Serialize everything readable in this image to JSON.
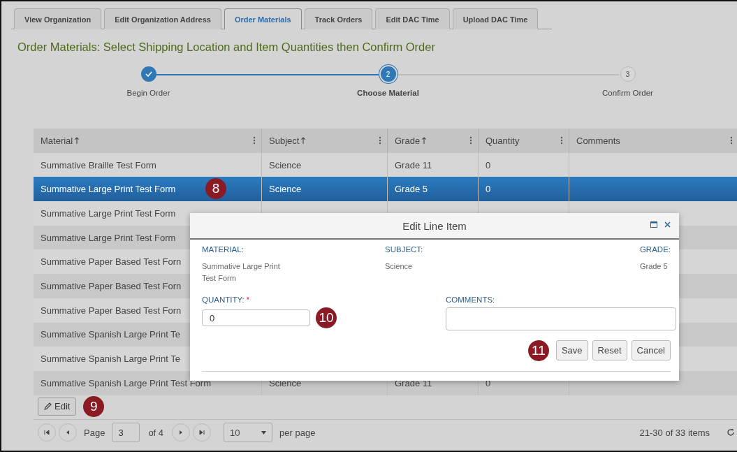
{
  "tabs": [
    {
      "label": "View Organization",
      "selected": false
    },
    {
      "label": "Edit Organization Address",
      "selected": false
    },
    {
      "label": "Order Materials",
      "selected": true
    },
    {
      "label": "Track Orders",
      "selected": false
    },
    {
      "label": "Edit DAC Time",
      "selected": false
    },
    {
      "label": "Upload DAC Time",
      "selected": false
    }
  ],
  "heading": "Order Materials: Select Shipping Location and Item Quantities then Confirm Order",
  "steps": [
    {
      "label": "Begin Order",
      "completed": true,
      "selected": false
    },
    {
      "label": "Choose Material",
      "number": "2",
      "completed": false,
      "selected": true
    },
    {
      "label": "Confirm Order",
      "number": "3",
      "completed": false,
      "selected": false
    }
  ],
  "grid": {
    "columns": [
      {
        "label": "Material",
        "sorted": true
      },
      {
        "label": "Subject",
        "sorted": true
      },
      {
        "label": "Grade",
        "sorted": true
      },
      {
        "label": "Quantity",
        "sorted": false
      },
      {
        "label": "Comments",
        "sorted": false
      }
    ],
    "rows": [
      {
        "cells": [
          "Summative Braille Test Form",
          "Science",
          "Grade 11",
          "0"
        ],
        "selected": false
      },
      {
        "cells": [
          "Summative Large Print Test Form",
          "Science",
          "Grade 5",
          "0"
        ],
        "selected": true,
        "callout": "8"
      },
      {
        "cells": [
          "Summative Large Print Test Form"
        ],
        "selected": false
      },
      {
        "cells": [
          "Summative Large Print Test Form"
        ],
        "selected": false
      },
      {
        "cells": [
          "Summative Paper Based Test Forn"
        ],
        "selected": false
      },
      {
        "cells": [
          "Summative Paper Based Test Forn"
        ],
        "selected": false
      },
      {
        "cells": [
          "Summative Paper Based Test Forn"
        ],
        "selected": false
      },
      {
        "cells": [
          "Summative Spanish Large Print Te"
        ],
        "selected": false
      },
      {
        "cells": [
          "Summative Spanish Large Print Te"
        ],
        "selected": false
      },
      {
        "cells": [
          "Summative Spanish Large Print Test Form",
          "Science",
          "Grade 11",
          "0"
        ],
        "selected": false
      }
    ]
  },
  "edit_button": {
    "label": "Edit",
    "callout": "9"
  },
  "pager": {
    "page_label": "Page",
    "page": "3",
    "of": "of 4",
    "page_size": "10",
    "per_page": "per page",
    "summary": "21-30 of 33 items"
  },
  "dialog": {
    "title": "Edit Line Item",
    "info": [
      {
        "label": "MATERIAL:",
        "value": "Summative Large Print Test Form"
      },
      {
        "label": "SUBJECT:",
        "value": "Science"
      },
      {
        "label": "GRADE:",
        "value": "Grade 5"
      }
    ],
    "quantity": {
      "label": "QUANTITY:",
      "required_mark": "*",
      "value": "0",
      "callout": "10"
    },
    "comments": {
      "label": "COMMENTS:"
    },
    "buttons_callout": "11",
    "buttons": [
      "Save",
      "Reset",
      "Cancel"
    ]
  }
}
